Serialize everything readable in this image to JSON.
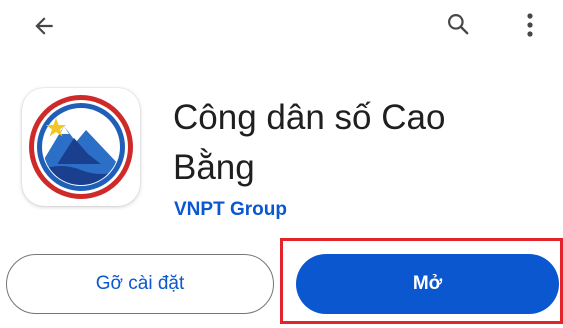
{
  "toolbar": {
    "back_icon": "arrow-left-icon",
    "search_icon": "search-icon",
    "more_icon": "more-vert-icon"
  },
  "app": {
    "title": "Công dân số Cao Bằng",
    "developer": "VNPT Group",
    "icon": "cao-bang-emblem-icon"
  },
  "actions": {
    "uninstall_label": "Gỡ cài đặt",
    "open_label": "Mở"
  },
  "colors": {
    "accent": "#0b57d0",
    "highlight": "#e3242b",
    "outline": "#747775"
  }
}
